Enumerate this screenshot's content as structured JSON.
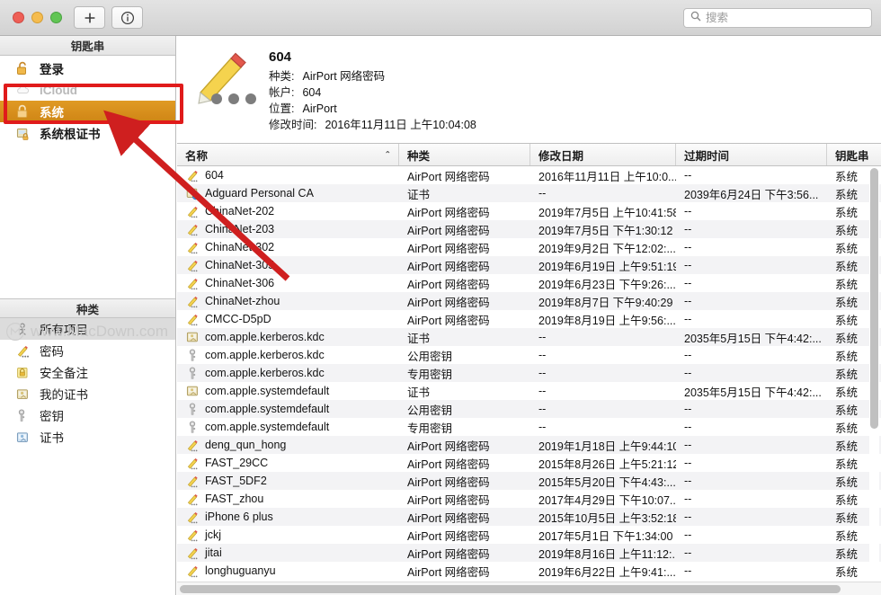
{
  "window": {
    "traffic_lights": [
      "close",
      "minimize",
      "maximize"
    ],
    "toolbar": {
      "add_label": "+",
      "add_icon": "plus-icon",
      "info_label": "i",
      "info_icon": "info-circle-icon"
    },
    "search": {
      "placeholder": "搜索",
      "value": "",
      "icon": "search-icon"
    }
  },
  "sidebar": {
    "keychains_header": "钥匙串",
    "keychains": [
      {
        "label": "登录",
        "icon": "lock-open-icon",
        "state": "normal"
      },
      {
        "label": "iCloud",
        "icon": "cloud-icon",
        "state": "disabled"
      },
      {
        "label": "系统",
        "icon": "lock-closed-icon",
        "state": "selected"
      },
      {
        "label": "系统根证书",
        "icon": "certificate-lock-icon",
        "state": "normal"
      }
    ],
    "categories_header": "种类",
    "categories": [
      {
        "label": "所有项目",
        "icon": "all-items-icon",
        "state": "selected"
      },
      {
        "label": "密码",
        "icon": "pencil-icon",
        "state": "normal"
      },
      {
        "label": "安全备注",
        "icon": "secure-note-icon",
        "state": "normal"
      },
      {
        "label": "我的证书",
        "icon": "my-certificate-icon",
        "state": "normal"
      },
      {
        "label": "密钥",
        "icon": "key-icon",
        "state": "normal"
      },
      {
        "label": "证书",
        "icon": "certificate-icon",
        "state": "normal"
      }
    ],
    "watermark": "www.MacDown.com"
  },
  "detail": {
    "icon": "pencil-password-icon",
    "title": "604",
    "fields": [
      {
        "label": "种类:",
        "value": "AirPort 网络密码"
      },
      {
        "label": "帐户:",
        "value": "604"
      },
      {
        "label": "位置:",
        "value": "AirPort"
      },
      {
        "label": "修改时间:",
        "value": "2016年11月11日 上午10:04:08"
      }
    ]
  },
  "table": {
    "columns": [
      {
        "key": "name",
        "label": "名称",
        "sorted": "asc",
        "sort_caret": "⌃"
      },
      {
        "key": "kind",
        "label": "种类"
      },
      {
        "key": "modified",
        "label": "修改日期"
      },
      {
        "key": "expires",
        "label": "过期时间"
      },
      {
        "key": "keychain",
        "label": "钥匙串"
      }
    ],
    "rows": [
      {
        "icon": "pencil-icon",
        "name": "604",
        "kind": "AirPort 网络密码",
        "modified": "2016年11月11日 上午10:0...",
        "expires": "--",
        "keychain": "系统"
      },
      {
        "icon": "certificate-blue-icon",
        "name": "Adguard Personal CA",
        "kind": "证书",
        "modified": "--",
        "expires": "2039年6月24日 下午3:56...",
        "keychain": "系统"
      },
      {
        "icon": "pencil-icon",
        "name": "ChinaNet-202",
        "kind": "AirPort 网络密码",
        "modified": "2019年7月5日 上午10:41:58",
        "expires": "--",
        "keychain": "系统"
      },
      {
        "icon": "pencil-icon",
        "name": "ChinaNet-203",
        "kind": "AirPort 网络密码",
        "modified": "2019年7月5日 下午1:30:12",
        "expires": "--",
        "keychain": "系统"
      },
      {
        "icon": "pencil-icon",
        "name": "ChinaNet-302",
        "kind": "AirPort 网络密码",
        "modified": "2019年9月2日 下午12:02:...",
        "expires": "--",
        "keychain": "系统"
      },
      {
        "icon": "pencil-icon",
        "name": "ChinaNet-305",
        "kind": "AirPort 网络密码",
        "modified": "2019年6月19日 上午9:51:19",
        "expires": "--",
        "keychain": "系统"
      },
      {
        "icon": "pencil-icon",
        "name": "ChinaNet-306",
        "kind": "AirPort 网络密码",
        "modified": "2019年6月23日 下午9:26:...",
        "expires": "--",
        "keychain": "系统"
      },
      {
        "icon": "pencil-icon",
        "name": "ChinaNet-zhou",
        "kind": "AirPort 网络密码",
        "modified": "2019年8月7日 下午9:40:29",
        "expires": "--",
        "keychain": "系统"
      },
      {
        "icon": "pencil-icon",
        "name": "CMCC-D5pD",
        "kind": "AirPort 网络密码",
        "modified": "2019年8月19日 上午9:56:...",
        "expires": "--",
        "keychain": "系统"
      },
      {
        "icon": "certificate-icon",
        "name": "com.apple.kerberos.kdc",
        "kind": "证书",
        "modified": "--",
        "expires": "2035年5月15日 下午4:42:...",
        "keychain": "系统"
      },
      {
        "icon": "key-icon",
        "name": "com.apple.kerberos.kdc",
        "kind": "公用密钥",
        "modified": "--",
        "expires": "--",
        "keychain": "系统"
      },
      {
        "icon": "key-icon",
        "name": "com.apple.kerberos.kdc",
        "kind": "专用密钥",
        "modified": "--",
        "expires": "--",
        "keychain": "系统"
      },
      {
        "icon": "certificate-icon",
        "name": "com.apple.systemdefault",
        "kind": "证书",
        "modified": "--",
        "expires": "2035年5月15日 下午4:42:...",
        "keychain": "系统"
      },
      {
        "icon": "key-icon",
        "name": "com.apple.systemdefault",
        "kind": "公用密钥",
        "modified": "--",
        "expires": "--",
        "keychain": "系统"
      },
      {
        "icon": "key-icon",
        "name": "com.apple.systemdefault",
        "kind": "专用密钥",
        "modified": "--",
        "expires": "--",
        "keychain": "系统"
      },
      {
        "icon": "pencil-icon",
        "name": "deng_qun_hong",
        "kind": "AirPort 网络密码",
        "modified": "2019年1月18日 上午9:44:10",
        "expires": "--",
        "keychain": "系统"
      },
      {
        "icon": "pencil-icon",
        "name": "FAST_29CC",
        "kind": "AirPort 网络密码",
        "modified": "2015年8月26日 上午5:21:12",
        "expires": "--",
        "keychain": "系统"
      },
      {
        "icon": "pencil-icon",
        "name": "FAST_5DF2",
        "kind": "AirPort 网络密码",
        "modified": "2015年5月20日 下午4:43:...",
        "expires": "--",
        "keychain": "系统"
      },
      {
        "icon": "pencil-icon",
        "name": "FAST_zhou",
        "kind": "AirPort 网络密码",
        "modified": "2017年4月29日 下午10:07...",
        "expires": "--",
        "keychain": "系统"
      },
      {
        "icon": "pencil-icon",
        "name": "iPhone 6 plus",
        "kind": "AirPort 网络密码",
        "modified": "2015年10月5日 上午3:52:18",
        "expires": "--",
        "keychain": "系统"
      },
      {
        "icon": "pencil-icon",
        "name": "jckj",
        "kind": "AirPort 网络密码",
        "modified": "2017年5月1日 下午1:34:00",
        "expires": "--",
        "keychain": "系统"
      },
      {
        "icon": "pencil-icon",
        "name": "jitai",
        "kind": "AirPort 网络密码",
        "modified": "2019年8月16日 上午11:12:...",
        "expires": "--",
        "keychain": "系统"
      },
      {
        "icon": "pencil-icon",
        "name": "longhuguanyu",
        "kind": "AirPort 网络密码",
        "modified": "2019年6月22日 上午9:41:...",
        "expires": "--",
        "keychain": "系统"
      }
    ]
  },
  "annotations": {
    "highlight_color": "#e01b1b",
    "box_target": "系统",
    "arrow": "red-arrow-pointing-to-system-keychain"
  },
  "colors": {
    "selection_orange": "#d8911c",
    "annotation_red": "#e01b1b",
    "row_alt": "#f3f3f5"
  }
}
